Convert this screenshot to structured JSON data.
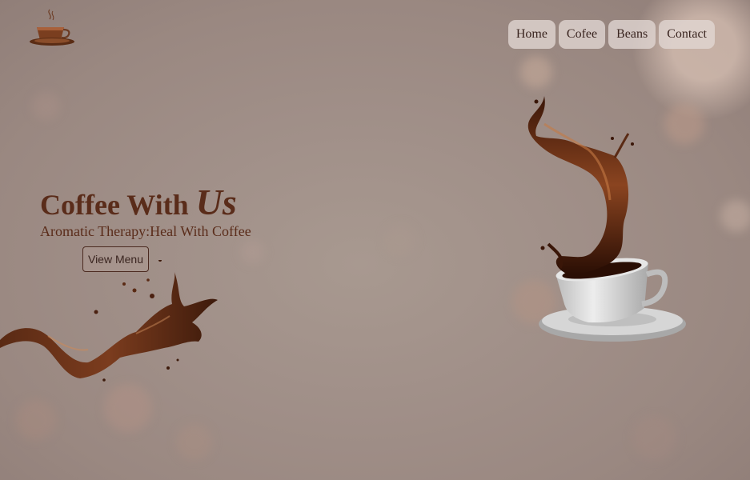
{
  "nav": {
    "items": [
      {
        "label": "Home"
      },
      {
        "label": "Cofee"
      },
      {
        "label": "Beans"
      },
      {
        "label": "Contact"
      }
    ]
  },
  "hero": {
    "title": "Coffee With",
    "title_emphasis": "Us",
    "subtitle": "Aromatic Therapy:Heal With Coffee",
    "button_label": "View Menu"
  },
  "icons": {
    "logo": "coffee-cup-logo-icon"
  },
  "colors": {
    "accent": "#5a2c1a",
    "nav_bg": "#e1d7d4",
    "background": "#a08f88"
  }
}
